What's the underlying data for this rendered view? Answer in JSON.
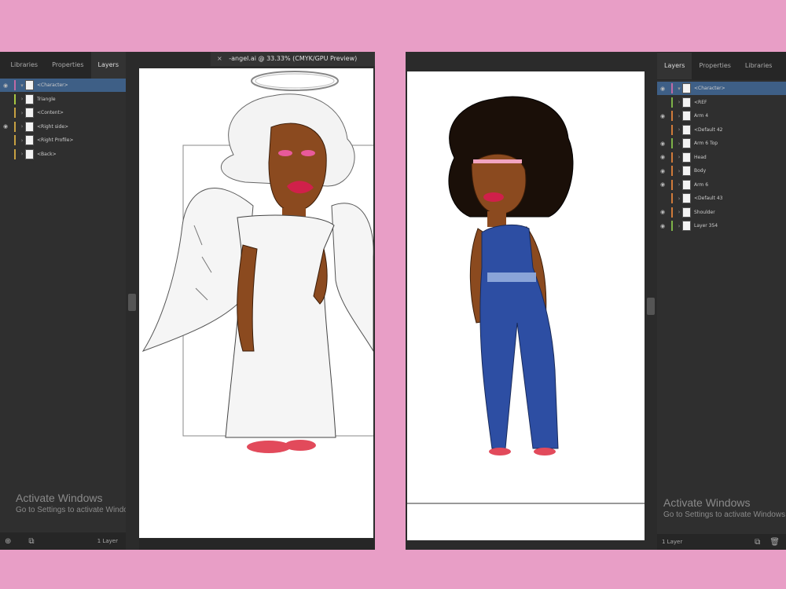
{
  "left_window": {
    "tabs": [
      "Layers",
      "Properties",
      "Libraries"
    ],
    "active_tab": "Layers",
    "layers": [
      {
        "name": "<Character>",
        "eye": true,
        "selected": true,
        "color": "#c06aa5"
      },
      {
        "name": "Triangle",
        "eye": false,
        "color": "#a7c742"
      },
      {
        "name": "<Content>",
        "eye": false,
        "color": "#c7a142"
      },
      {
        "name": "<Right side>",
        "eye": true,
        "color": "#c7a142"
      },
      {
        "name": "<Right Profile>",
        "eye": false,
        "color": "#c7a142"
      },
      {
        "name": "<Back>",
        "eye": false,
        "color": "#c7a142"
      }
    ],
    "document_tab": {
      "close": "×",
      "title": "-angel.ai @ 33.33% (CMYK/GPU Preview)"
    },
    "watermark": {
      "title": "Activate Windows",
      "subtitle": "Go to Settings to activate Windows."
    },
    "status": {
      "layers_count": "1 Layer"
    }
  },
  "right_window": {
    "tabs": [
      "Layers",
      "Properties",
      "Libraries"
    ],
    "active_tab": "Layers",
    "layers": [
      {
        "name": "<Character>",
        "eye": true,
        "selected": true,
        "color": "#c06aa5",
        "top": true
      },
      {
        "name": "<REF",
        "eye": false,
        "color": "#7db248"
      },
      {
        "name": "Arm 4",
        "eye": true,
        "color": "#d07a3a"
      },
      {
        "name": "<Default 42",
        "eye": false,
        "color": "#d07a3a"
      },
      {
        "name": "Arm 6 Top",
        "eye": true,
        "color": "#7db248"
      },
      {
        "name": "Head",
        "eye": true,
        "color": "#d07a3a"
      },
      {
        "name": "Body",
        "eye": true,
        "color": "#d07a3a"
      },
      {
        "name": "Arm 6",
        "eye": true,
        "color": "#d07a3a"
      },
      {
        "name": "<Default 43",
        "eye": false,
        "color": "#d07a3a"
      },
      {
        "name": "Shoulder",
        "eye": true,
        "color": "#d07a3a"
      },
      {
        "name": "Layer 354",
        "eye": true,
        "color": "#7db248"
      }
    ],
    "watermark": {
      "title": "Activate Windows",
      "subtitle": "Go to Settings to activate Windows."
    },
    "status": {
      "layers_count": "1 Layer"
    }
  },
  "icons": {
    "eye": "eye-icon",
    "chevron": "chevron-right-icon",
    "new_layer": "new-layer-icon",
    "delete": "trash-icon"
  },
  "colors": {
    "background": "#e89ec6",
    "panel": "#2b2b2b",
    "selection": "#3e5f86"
  }
}
